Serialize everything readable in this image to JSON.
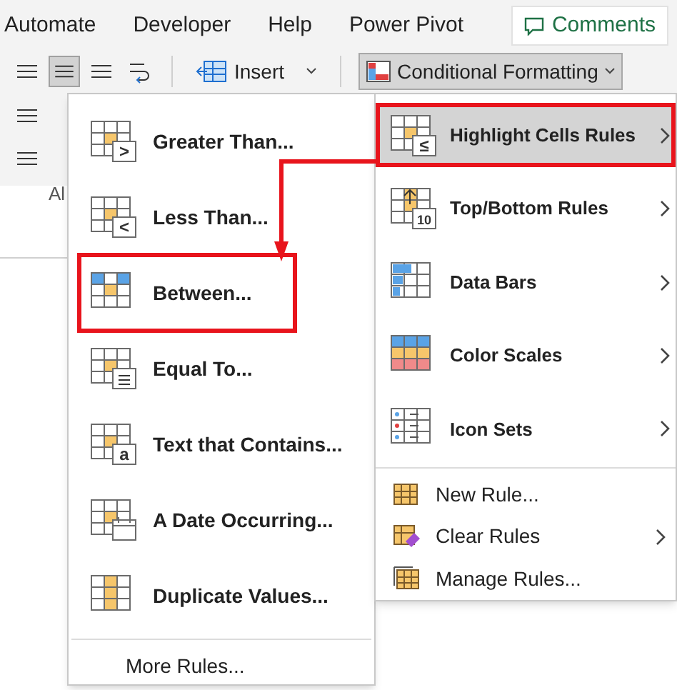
{
  "ribbon_tabs": [
    {
      "label": "Automate"
    },
    {
      "label": "Developer"
    },
    {
      "label": "Help"
    },
    {
      "label": "Power Pivot"
    }
  ],
  "comments_button": {
    "label": "Comments"
  },
  "toolbar": {
    "insert_button": {
      "label": "Insert"
    },
    "conditional_formatting_button": {
      "label": "Conditional Formatting",
      "pressed": true
    }
  },
  "group_label": "Al",
  "submenu": {
    "items": [
      {
        "label": "Greater Than...",
        "kind": "greater",
        "icon_text": ">",
        "callout": false
      },
      {
        "label": "Less Than...",
        "kind": "less",
        "icon_text": "<",
        "callout": false
      },
      {
        "label": "Between...",
        "kind": "between",
        "callout": true
      },
      {
        "label": "Equal To...",
        "kind": "equal",
        "callout": false
      },
      {
        "label": "Text that Contains...",
        "kind": "text",
        "icon_text": "a",
        "callout": false
      },
      {
        "label": "A Date Occurring...",
        "kind": "date",
        "callout": false
      },
      {
        "label": "Duplicate Values...",
        "kind": "duplicate",
        "callout": false
      }
    ],
    "more_rules": "More Rules..."
  },
  "main_menu": {
    "rule_types": [
      {
        "label": "Highlight Cells Rules",
        "kind": "highlight",
        "icon_text": "≤",
        "selected": true,
        "callout": true
      },
      {
        "label": "Top/Bottom Rules",
        "kind": "topbottom",
        "icon_text": "10",
        "selected": false,
        "callout": false
      },
      {
        "label": "Data Bars",
        "kind": "databars",
        "selected": false,
        "callout": false
      },
      {
        "label": "Color Scales",
        "kind": "colorscales",
        "selected": false,
        "callout": false
      },
      {
        "label": "Icon Sets",
        "kind": "iconsets",
        "selected": false,
        "callout": false
      }
    ],
    "actions": [
      {
        "label": "New Rule...",
        "kind": "newrule",
        "has_submenu": false
      },
      {
        "label": "Clear Rules",
        "kind": "clearrules",
        "has_submenu": true
      },
      {
        "label": "Manage Rules...",
        "kind": "managerules",
        "has_submenu": false
      }
    ]
  }
}
